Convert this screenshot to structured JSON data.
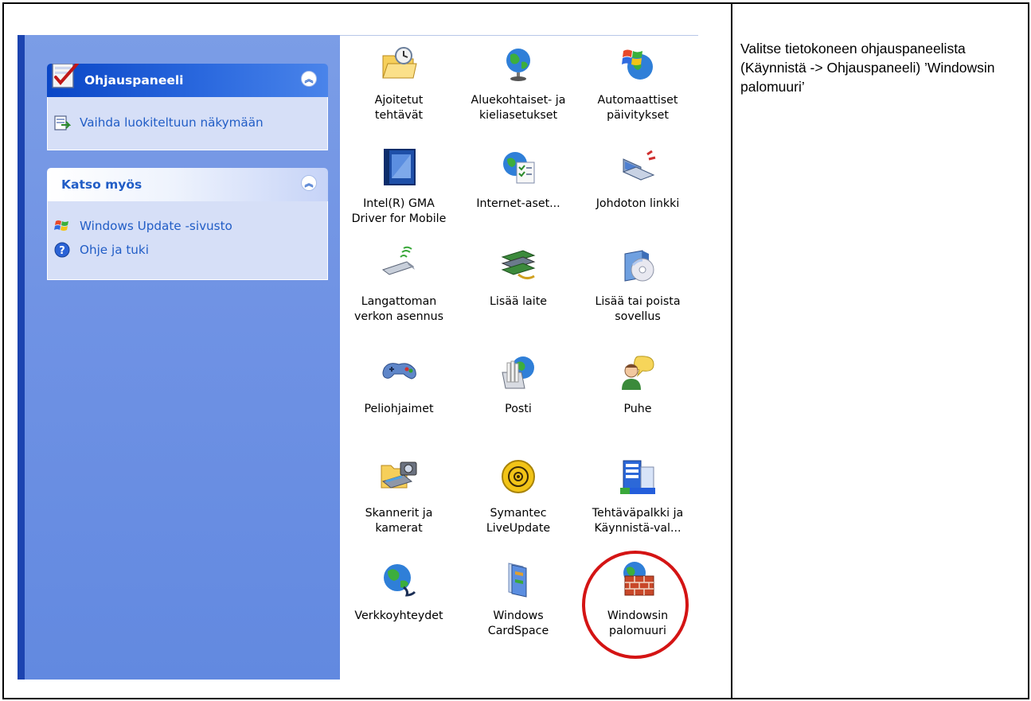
{
  "instruction_text": "Valitse tietokoneen ohjauspaneelista (Käynnistä -> Ohjauspaneeli) ’Windowsin palomuuri’",
  "task_pane": {
    "panel1": {
      "title": "Ohjauspaneeli",
      "link": "Vaihda luokiteltuun näkymään",
      "title_icon": "control-panel-icon",
      "link_icon": "switch-view-icon"
    },
    "panel2": {
      "title": "Katso myös",
      "links": [
        {
          "label": "Windows Update -sivusto",
          "icon": "windows-update-icon"
        },
        {
          "label": "Ohje ja tuki",
          "icon": "help-icon"
        }
      ]
    }
  },
  "icons": [
    {
      "label": "Ajoitetut\ntehtävät",
      "icon": "scheduled-tasks-icon"
    },
    {
      "label": "Aluekohtaiset- ja\nkieliasetukset",
      "icon": "globe-icon"
    },
    {
      "label": "Automaattiset\npäivitykset",
      "icon": "windows-update-icon"
    },
    {
      "label": "Intel(R) GMA\nDriver for Mobile",
      "icon": "intel-gma-icon"
    },
    {
      "label": "Internet-aset...",
      "icon": "internet-options-icon"
    },
    {
      "label": "Johdoton linkki",
      "icon": "wireless-link-icon"
    },
    {
      "label": "Langattoman\nverkon asennus",
      "icon": "wireless-setup-icon"
    },
    {
      "label": "Lisää laite",
      "icon": "add-hardware-icon"
    },
    {
      "label": "Lisää tai poista\nsovellus",
      "icon": "add-remove-programs-icon"
    },
    {
      "label": "Peliohjaimet",
      "icon": "game-controller-icon"
    },
    {
      "label": "Posti",
      "icon": "mail-icon"
    },
    {
      "label": "Puhe",
      "icon": "speech-icon"
    },
    {
      "label": "Skannerit ja\nkamerat",
      "icon": "scanner-camera-icon"
    },
    {
      "label": "Symantec\nLiveUpdate",
      "icon": "symantec-icon"
    },
    {
      "label": "Tehtäväpalkki ja\nKäynnistä-val...",
      "icon": "taskbar-icon"
    },
    {
      "label": "Verkkoyhteydet",
      "icon": "network-connections-icon"
    },
    {
      "label": "Windows\nCardSpace",
      "icon": "cardspace-icon"
    },
    {
      "label": "Windowsin\npalomuuri",
      "icon": "firewall-icon"
    }
  ],
  "colors": {
    "task_pane": "#6f92e4",
    "link": "#215dc6",
    "highlight": "#d41414"
  }
}
